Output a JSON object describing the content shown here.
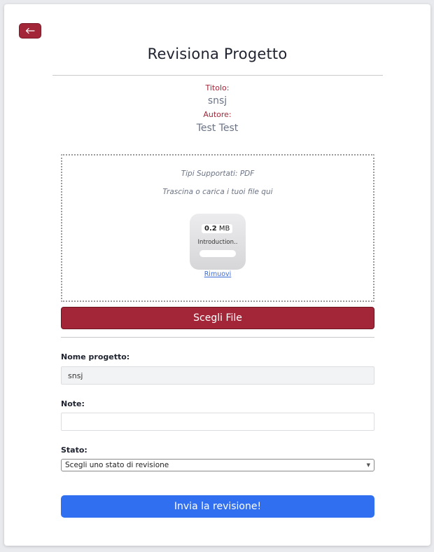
{
  "header": {
    "back_icon": "arrow-left-icon",
    "title": "Revisiona Progetto"
  },
  "project_meta": {
    "title_label": "Titolo:",
    "title_value": "snsj",
    "author_label": "Autore:",
    "author_value": "Test Test"
  },
  "upload": {
    "supported_types": "Tipi Supportati: PDF",
    "instructions": "Trascina o carica i tuoi file qui",
    "file": {
      "size_value": "0.2",
      "size_unit": "MB",
      "name": "Introduction..",
      "progress": 0
    },
    "remove_label": "Rimuovi",
    "choose_button": "Scegli File"
  },
  "form": {
    "project_name_label": "Nome progetto:",
    "project_name_value": "snsj",
    "notes_label": "Note:",
    "notes_value": "",
    "state_label": "Stato:",
    "state_selected": "Scegli uno stato di revisione",
    "submit_button": "Invia la revisione!"
  },
  "colors": {
    "accent": "#a32638",
    "primary": "#2f6ff0",
    "muted_text": "#6b7385"
  }
}
